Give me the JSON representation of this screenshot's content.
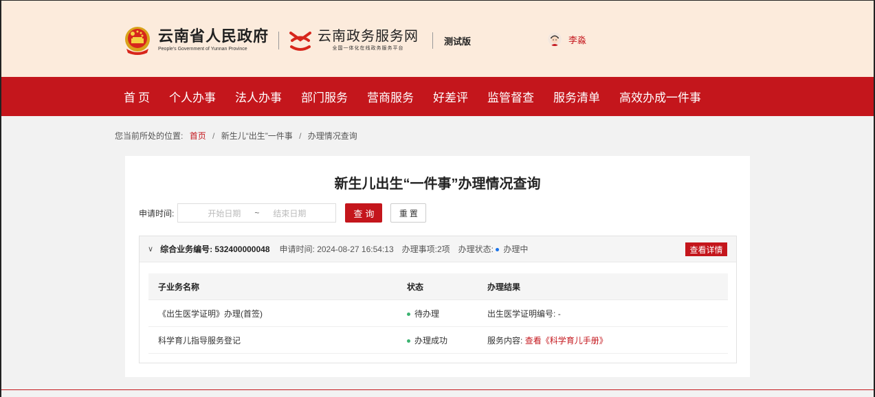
{
  "header": {
    "gov_title": "云南省人民政府",
    "gov_title_en": "People's Government of Yunnan Province",
    "portal_title": "云南政务服务网",
    "portal_subtitle": "全国一体化在线政务服务平台",
    "env_tag": "测试版",
    "user_name": "李淼"
  },
  "nav": {
    "items": [
      {
        "label": "首页"
      },
      {
        "label": "个人办事"
      },
      {
        "label": "法人办事"
      },
      {
        "label": "部门服务"
      },
      {
        "label": "营商服务"
      },
      {
        "label": "好差评"
      },
      {
        "label": "监管督查"
      },
      {
        "label": "服务清单"
      },
      {
        "label": "高效办成一件事"
      }
    ]
  },
  "breadcrumb": {
    "prefix": "您当前所处的位置:",
    "items": [
      "首页",
      "新生儿“出生”一件事",
      "办理情况查询"
    ],
    "sep": "/"
  },
  "page": {
    "title": "新生儿出生“一件事”办理情况查询"
  },
  "search": {
    "label": "申请时间:",
    "start_placeholder": "开始日期",
    "range_sep": "~",
    "end_placeholder": "结束日期",
    "query_label": "查询",
    "reset_label": "重置"
  },
  "record": {
    "biz_no_label": "综合业务编号:",
    "biz_no": "532400000048",
    "apply_time_label": "申请时间:",
    "apply_time": "2024-08-27 16:54:13",
    "items_label": "办理事项:",
    "items_count": "2项",
    "status_label": "办理状态:",
    "status": "办理中",
    "detail_label": "查看详情",
    "status_color": "#1a73e8"
  },
  "sub_table": {
    "headers": [
      "子业务名称",
      "状态",
      "办理结果"
    ],
    "rows": [
      {
        "name": "《出生医学证明》办理(首签)",
        "status": "待办理",
        "result_label": "出生医学证明编号:",
        "result_value": "-",
        "result_link": ""
      },
      {
        "name": "科学育儿指导服务登记",
        "status": "办理成功",
        "result_label": "服务内容:",
        "result_value": "",
        "result_link": "查看《科学育儿手册》"
      }
    ],
    "status_color": "#3cb371"
  },
  "colors": {
    "brand_red": "#c4161c",
    "header_bg": "#fcebdc"
  }
}
